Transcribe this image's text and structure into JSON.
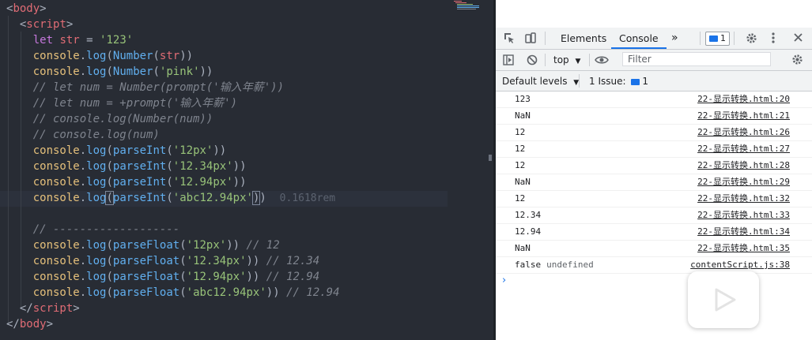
{
  "editor": {
    "lines": [
      [
        [
          "t-punc",
          "<"
        ],
        [
          "t-tag",
          "body"
        ],
        [
          "t-punc",
          ">"
        ]
      ],
      [
        [
          "t-punc",
          "  <"
        ],
        [
          "t-tag",
          "script"
        ],
        [
          "t-punc",
          ">"
        ]
      ],
      [
        [
          "t-punc",
          "    "
        ],
        [
          "t-kw",
          "let"
        ],
        [
          "t-punc",
          " "
        ],
        [
          "t-var",
          "str"
        ],
        [
          "t-punc",
          " = "
        ],
        [
          "t-str",
          "'123'"
        ]
      ],
      [
        [
          "t-punc",
          "    "
        ],
        [
          "t-obj",
          "console"
        ],
        [
          "t-punc",
          "."
        ],
        [
          "t-fn",
          "log"
        ],
        [
          "t-punc",
          "("
        ],
        [
          "t-fn",
          "Number"
        ],
        [
          "t-punc",
          "("
        ],
        [
          "t-var",
          "str"
        ],
        [
          "t-punc",
          "))"
        ]
      ],
      [
        [
          "t-punc",
          "    "
        ],
        [
          "t-obj",
          "console"
        ],
        [
          "t-punc",
          "."
        ],
        [
          "t-fn",
          "log"
        ],
        [
          "t-punc",
          "("
        ],
        [
          "t-fn",
          "Number"
        ],
        [
          "t-punc",
          "("
        ],
        [
          "t-str",
          "'pink'"
        ],
        [
          "t-punc",
          "))"
        ]
      ],
      [
        [
          "t-punc",
          "    "
        ],
        [
          "t-cmt",
          "// let num = Number(prompt('输入年薪'))"
        ]
      ],
      [
        [
          "t-punc",
          "    "
        ],
        [
          "t-cmt",
          "// let num = +prompt('输入年薪')"
        ]
      ],
      [
        [
          "t-punc",
          "    "
        ],
        [
          "t-cmt",
          "// console.log(Number(num))"
        ]
      ],
      [
        [
          "t-punc",
          "    "
        ],
        [
          "t-cmt",
          "// console.log(num)"
        ]
      ],
      [
        [
          "t-punc",
          "    "
        ],
        [
          "t-obj",
          "console"
        ],
        [
          "t-punc",
          "."
        ],
        [
          "t-fn",
          "log"
        ],
        [
          "t-punc",
          "("
        ],
        [
          "t-fn",
          "parseInt"
        ],
        [
          "t-punc",
          "("
        ],
        [
          "t-str",
          "'12px'"
        ],
        [
          "t-punc",
          "))"
        ]
      ],
      [
        [
          "t-punc",
          "    "
        ],
        [
          "t-obj",
          "console"
        ],
        [
          "t-punc",
          "."
        ],
        [
          "t-fn",
          "log"
        ],
        [
          "t-punc",
          "("
        ],
        [
          "t-fn",
          "parseInt"
        ],
        [
          "t-punc",
          "("
        ],
        [
          "t-str",
          "'12.34px'"
        ],
        [
          "t-punc",
          "))"
        ]
      ],
      [
        [
          "t-punc",
          "    "
        ],
        [
          "t-obj",
          "console"
        ],
        [
          "t-punc",
          "."
        ],
        [
          "t-fn",
          "log"
        ],
        [
          "t-punc",
          "("
        ],
        [
          "t-fn",
          "parseInt"
        ],
        [
          "t-punc",
          "("
        ],
        [
          "t-str",
          "'12.94px'"
        ],
        [
          "t-punc",
          "))"
        ]
      ],
      [
        [
          "t-punc",
          "    "
        ],
        [
          "t-obj",
          "console"
        ],
        [
          "t-punc",
          "."
        ],
        [
          "t-fn",
          "log"
        ],
        [
          "cursor",
          "("
        ],
        [
          "t-fn",
          "parseInt"
        ],
        [
          "t-punc",
          "("
        ],
        [
          "t-str",
          "'abc12.94px'"
        ],
        [
          "cursor",
          ")"
        ],
        [
          "t-punc",
          ")"
        ],
        [
          "t-punc",
          "  "
        ],
        [
          "t-hint",
          "0.1618rem"
        ]
      ],
      [],
      [
        [
          "t-punc",
          "    "
        ],
        [
          "t-cmt",
          "// -------------------"
        ]
      ],
      [
        [
          "t-punc",
          "    "
        ],
        [
          "t-obj",
          "console"
        ],
        [
          "t-punc",
          "."
        ],
        [
          "t-fn",
          "log"
        ],
        [
          "t-punc",
          "("
        ],
        [
          "t-fn",
          "parseFloat"
        ],
        [
          "t-punc",
          "("
        ],
        [
          "t-str",
          "'12px'"
        ],
        [
          "t-punc",
          ")) "
        ],
        [
          "t-cmt",
          "// 12"
        ]
      ],
      [
        [
          "t-punc",
          "    "
        ],
        [
          "t-obj",
          "console"
        ],
        [
          "t-punc",
          "."
        ],
        [
          "t-fn",
          "log"
        ],
        [
          "t-punc",
          "("
        ],
        [
          "t-fn",
          "parseFloat"
        ],
        [
          "t-punc",
          "("
        ],
        [
          "t-str",
          "'12.34px'"
        ],
        [
          "t-punc",
          ")) "
        ],
        [
          "t-cmt",
          "// 12.34"
        ]
      ],
      [
        [
          "t-punc",
          "    "
        ],
        [
          "t-obj",
          "console"
        ],
        [
          "t-punc",
          "."
        ],
        [
          "t-fn",
          "log"
        ],
        [
          "t-punc",
          "("
        ],
        [
          "t-fn",
          "parseFloat"
        ],
        [
          "t-punc",
          "("
        ],
        [
          "t-str",
          "'12.94px'"
        ],
        [
          "t-punc",
          ")) "
        ],
        [
          "t-cmt",
          "// 12.94"
        ]
      ],
      [
        [
          "t-punc",
          "    "
        ],
        [
          "t-obj",
          "console"
        ],
        [
          "t-punc",
          "."
        ],
        [
          "t-fn",
          "log"
        ],
        [
          "t-punc",
          "("
        ],
        [
          "t-fn",
          "parseFloat"
        ],
        [
          "t-punc",
          "("
        ],
        [
          "t-str",
          "'abc12.94px'"
        ],
        [
          "t-punc",
          ")) "
        ],
        [
          "t-cmt",
          "// 12.94"
        ]
      ],
      [
        [
          "t-punc",
          "  </"
        ],
        [
          "t-tag",
          "script"
        ],
        [
          "t-punc",
          ">"
        ]
      ],
      [
        [
          "t-punc",
          "</"
        ],
        [
          "t-tag",
          "body"
        ],
        [
          "t-punc",
          ">"
        ]
      ]
    ]
  },
  "devtools": {
    "tabs": {
      "elements": "Elements",
      "console": "Console",
      "more": "»"
    },
    "issues_badge_count": "1",
    "context": "top",
    "filter_placeholder": "Filter",
    "default_levels": "Default levels",
    "issues_label": "1 Issue:",
    "issues_count": "1",
    "log": [
      {
        "value": "123",
        "source": "22-显示转换.html:20"
      },
      {
        "value": "NaN",
        "source": "22-显示转换.html:21"
      },
      {
        "value": "12",
        "source": "22-显示转换.html:26"
      },
      {
        "value": "12",
        "source": "22-显示转换.html:27"
      },
      {
        "value": "12",
        "source": "22-显示转换.html:28"
      },
      {
        "value": "NaN",
        "source": "22-显示转换.html:29"
      },
      {
        "value": "12",
        "source": "22-显示转换.html:32"
      },
      {
        "value": "12.34",
        "source": "22-显示转换.html:33"
      },
      {
        "value": "12.94",
        "source": "22-显示转换.html:34"
      },
      {
        "value": "NaN",
        "source": "22-显示转换.html:35"
      },
      {
        "value": "false",
        "extra": "undefined",
        "source": "contentScript.js:38"
      }
    ],
    "prompt": "›"
  },
  "colors": {
    "accent": "#1a73e8",
    "editor_bg": "#282c34"
  }
}
